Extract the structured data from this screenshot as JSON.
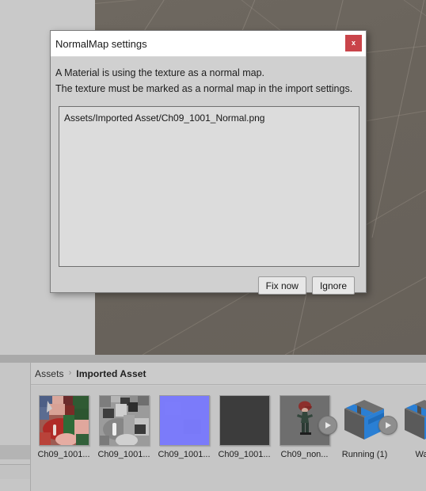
{
  "editor": {
    "scene_view_name": "scene-view",
    "background_color": "#6b655e",
    "panel_background": "#c9c9c9"
  },
  "dialog": {
    "title": "NormalMap settings",
    "close_label": "x",
    "close_color": "#c9444a",
    "message_line_1": "A Material is using the texture as a normal map.",
    "message_line_2": "The texture must be marked as a normal map in the import settings.",
    "list_items": [
      "Assets/Imported Asset/Ch09_1001_Normal.png"
    ],
    "buttons": {
      "fix": "Fix now",
      "ignore": "Ignore"
    }
  },
  "project_panel": {
    "breadcrumb": {
      "root": "Assets",
      "separator": "›",
      "current": "Imported Asset"
    },
    "assets": [
      {
        "label": "Ch09_1001...",
        "kind": "texture-color",
        "has_play_badge": false
      },
      {
        "label": "Ch09_1001...",
        "kind": "texture-gray",
        "has_play_badge": false
      },
      {
        "label": "Ch09_1001...",
        "kind": "texture-normal",
        "has_play_badge": false
      },
      {
        "label": "Ch09_1001...",
        "kind": "texture-dark",
        "has_play_badge": false
      },
      {
        "label": "Ch09_non...",
        "kind": "model-preview",
        "has_play_badge": true
      },
      {
        "label": "Running (1)",
        "kind": "prefab",
        "has_play_badge": true
      },
      {
        "label": "Walk",
        "kind": "prefab",
        "has_play_badge": true
      }
    ]
  }
}
